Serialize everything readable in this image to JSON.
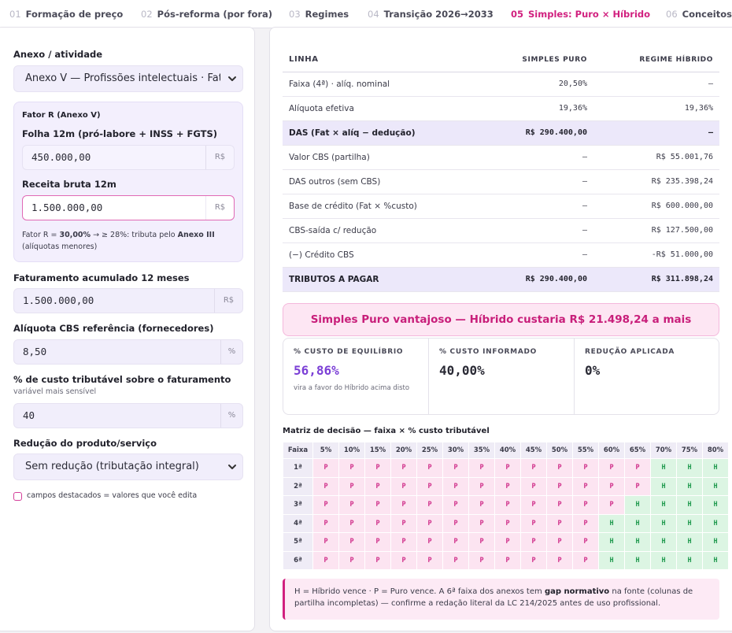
{
  "tabs": [
    {
      "num": "01",
      "label": "Formação de preço"
    },
    {
      "num": "02",
      "label": "Pós-reforma (por fora)"
    },
    {
      "num": "03",
      "label": "Regimes"
    },
    {
      "num": "04",
      "label": "Transição 2026→2033"
    },
    {
      "num": "05",
      "label": "Simples: Puro × Híbrido"
    },
    {
      "num": "06",
      "label": "Conceitos"
    }
  ],
  "active_tab": "05",
  "form": {
    "anexo_label": "Anexo / atividade",
    "anexo_value": "Anexo V — Profissões intelectuais · Fator R",
    "fator_r_title": "Fator R (Anexo V)",
    "folha_label": "Folha 12m (pró-labore + INSS + FGTS)",
    "folha_value": "450.000,00",
    "folha_unit": "R$",
    "receita_label": "Receita bruta 12m",
    "receita_value": "1.500.000,00",
    "receita_unit": "R$",
    "fator_note_pre": "Fator R = ",
    "fator_note_value": "30,00%",
    "fator_note_mid": " → ≥ 28%: tributa pelo ",
    "fator_note_anexo": "Anexo III",
    "fator_note_post": "(alíquotas menores)",
    "fat_label": "Faturamento acumulado 12 meses",
    "fat_value": "1.500.000,00",
    "fat_unit": "R$",
    "cbs_label": "Alíquota CBS referência (fornecedores)",
    "cbs_value": "8,50",
    "cbs_unit": "%",
    "custo_label": "% de custo tributável sobre o faturamento",
    "custo_sub": "variável mais sensível",
    "custo_value": "40",
    "custo_unit": "%",
    "reducao_label": "Redução do produto/serviço",
    "reducao_value": "Sem redução (tributação integral)",
    "check_note": "campos destacados = valores que você edita"
  },
  "table": {
    "headers": [
      "LINHA",
      "SIMPLES PURO",
      "REGIME HÍBRIDO"
    ],
    "rows": [
      {
        "label": "Faixa (4ª) · alíq. nominal",
        "puro": "20,50%",
        "hibrido": "–",
        "hl": false
      },
      {
        "label": "Alíquota efetiva",
        "puro": "19,36%",
        "hibrido": "19,36%",
        "hl": false
      },
      {
        "label": "DAS (Fat × alíq − dedução)",
        "puro": "R$ 290.400,00",
        "hibrido": "–",
        "hl": true
      },
      {
        "label": "Valor CBS (partilha)",
        "puro": "–",
        "hibrido": "R$ 55.001,76",
        "hl": false
      },
      {
        "label": "DAS outros (sem CBS)",
        "puro": "–",
        "hibrido": "R$ 235.398,24",
        "hl": false
      },
      {
        "label": "Base de crédito (Fat × %custo)",
        "puro": "–",
        "hibrido": "R$ 600.000,00",
        "hl": false
      },
      {
        "label": "CBS-saída c/ redução",
        "puro": "–",
        "hibrido": "R$ 127.500,00",
        "hl": false
      },
      {
        "label": "(−) Crédito CBS",
        "puro": "–",
        "hibrido": "-R$ 51.000,00",
        "hl": false
      },
      {
        "label": "TRIBUTOS A PAGAR",
        "puro": "R$ 290.400,00",
        "hibrido": "R$ 311.898,24",
        "hl": true
      }
    ]
  },
  "banner": "Simples Puro vantajoso — Híbrido custaria R$ 21.498,24 a mais",
  "stats": [
    {
      "key": "% CUSTO DE EQUILÍBRIO",
      "value": "56,86%",
      "hint": "vira a favor do Híbrido acima disto",
      "accent": true
    },
    {
      "key": "% CUSTO INFORMADO",
      "value": "40,00%",
      "hint": "",
      "accent": false
    },
    {
      "key": "REDUÇÃO APLICADA",
      "value": "0%",
      "hint": "",
      "accent": false
    }
  ],
  "matrix": {
    "title": "Matriz de decisão — faixa × % custo tributável",
    "corner": "Faixa",
    "cols": [
      "5%",
      "10%",
      "15%",
      "20%",
      "25%",
      "30%",
      "35%",
      "40%",
      "45%",
      "50%",
      "55%",
      "60%",
      "65%",
      "70%",
      "75%",
      "80%"
    ],
    "rows": [
      {
        "faixa": "1ª",
        "cells": [
          "P",
          "P",
          "P",
          "P",
          "P",
          "P",
          "P",
          "P",
          "P",
          "P",
          "P",
          "P",
          "P",
          "H",
          "H",
          "H"
        ]
      },
      {
        "faixa": "2ª",
        "cells": [
          "P",
          "P",
          "P",
          "P",
          "P",
          "P",
          "P",
          "P",
          "P",
          "P",
          "P",
          "P",
          "P",
          "H",
          "H",
          "H"
        ]
      },
      {
        "faixa": "3ª",
        "cells": [
          "P",
          "P",
          "P",
          "P",
          "P",
          "P",
          "P",
          "P",
          "P",
          "P",
          "P",
          "P",
          "H",
          "H",
          "H",
          "H"
        ]
      },
      {
        "faixa": "4ª",
        "cells": [
          "P",
          "P",
          "P",
          "P",
          "P",
          "P",
          "P",
          "P",
          "P",
          "P",
          "P",
          "H",
          "H",
          "H",
          "H",
          "H"
        ]
      },
      {
        "faixa": "5ª",
        "cells": [
          "P",
          "P",
          "P",
          "P",
          "P",
          "P",
          "P",
          "P",
          "P",
          "P",
          "P",
          "H",
          "H",
          "H",
          "H",
          "H"
        ]
      },
      {
        "faixa": "6ª",
        "cells": [
          "P",
          "P",
          "P",
          "P",
          "P",
          "P",
          "P",
          "P",
          "P",
          "P",
          "P",
          "H",
          "H",
          "H",
          "H",
          "H"
        ]
      }
    ]
  },
  "legend": {
    "pre": "H = Híbrido vence · P = Puro vence. A 6ª faixa dos anexos tem ",
    "bold": "gap normativo",
    "post": " na fonte (colunas de partilha incompletas) — confirme a redação literal da LC 214/2025 antes de uso profissional."
  },
  "colors": {
    "accent": "#d1207f",
    "purple": "#7b3fd6",
    "puro_bg": "#fce4f1",
    "hibrido_bg": "#dcf5e3"
  }
}
